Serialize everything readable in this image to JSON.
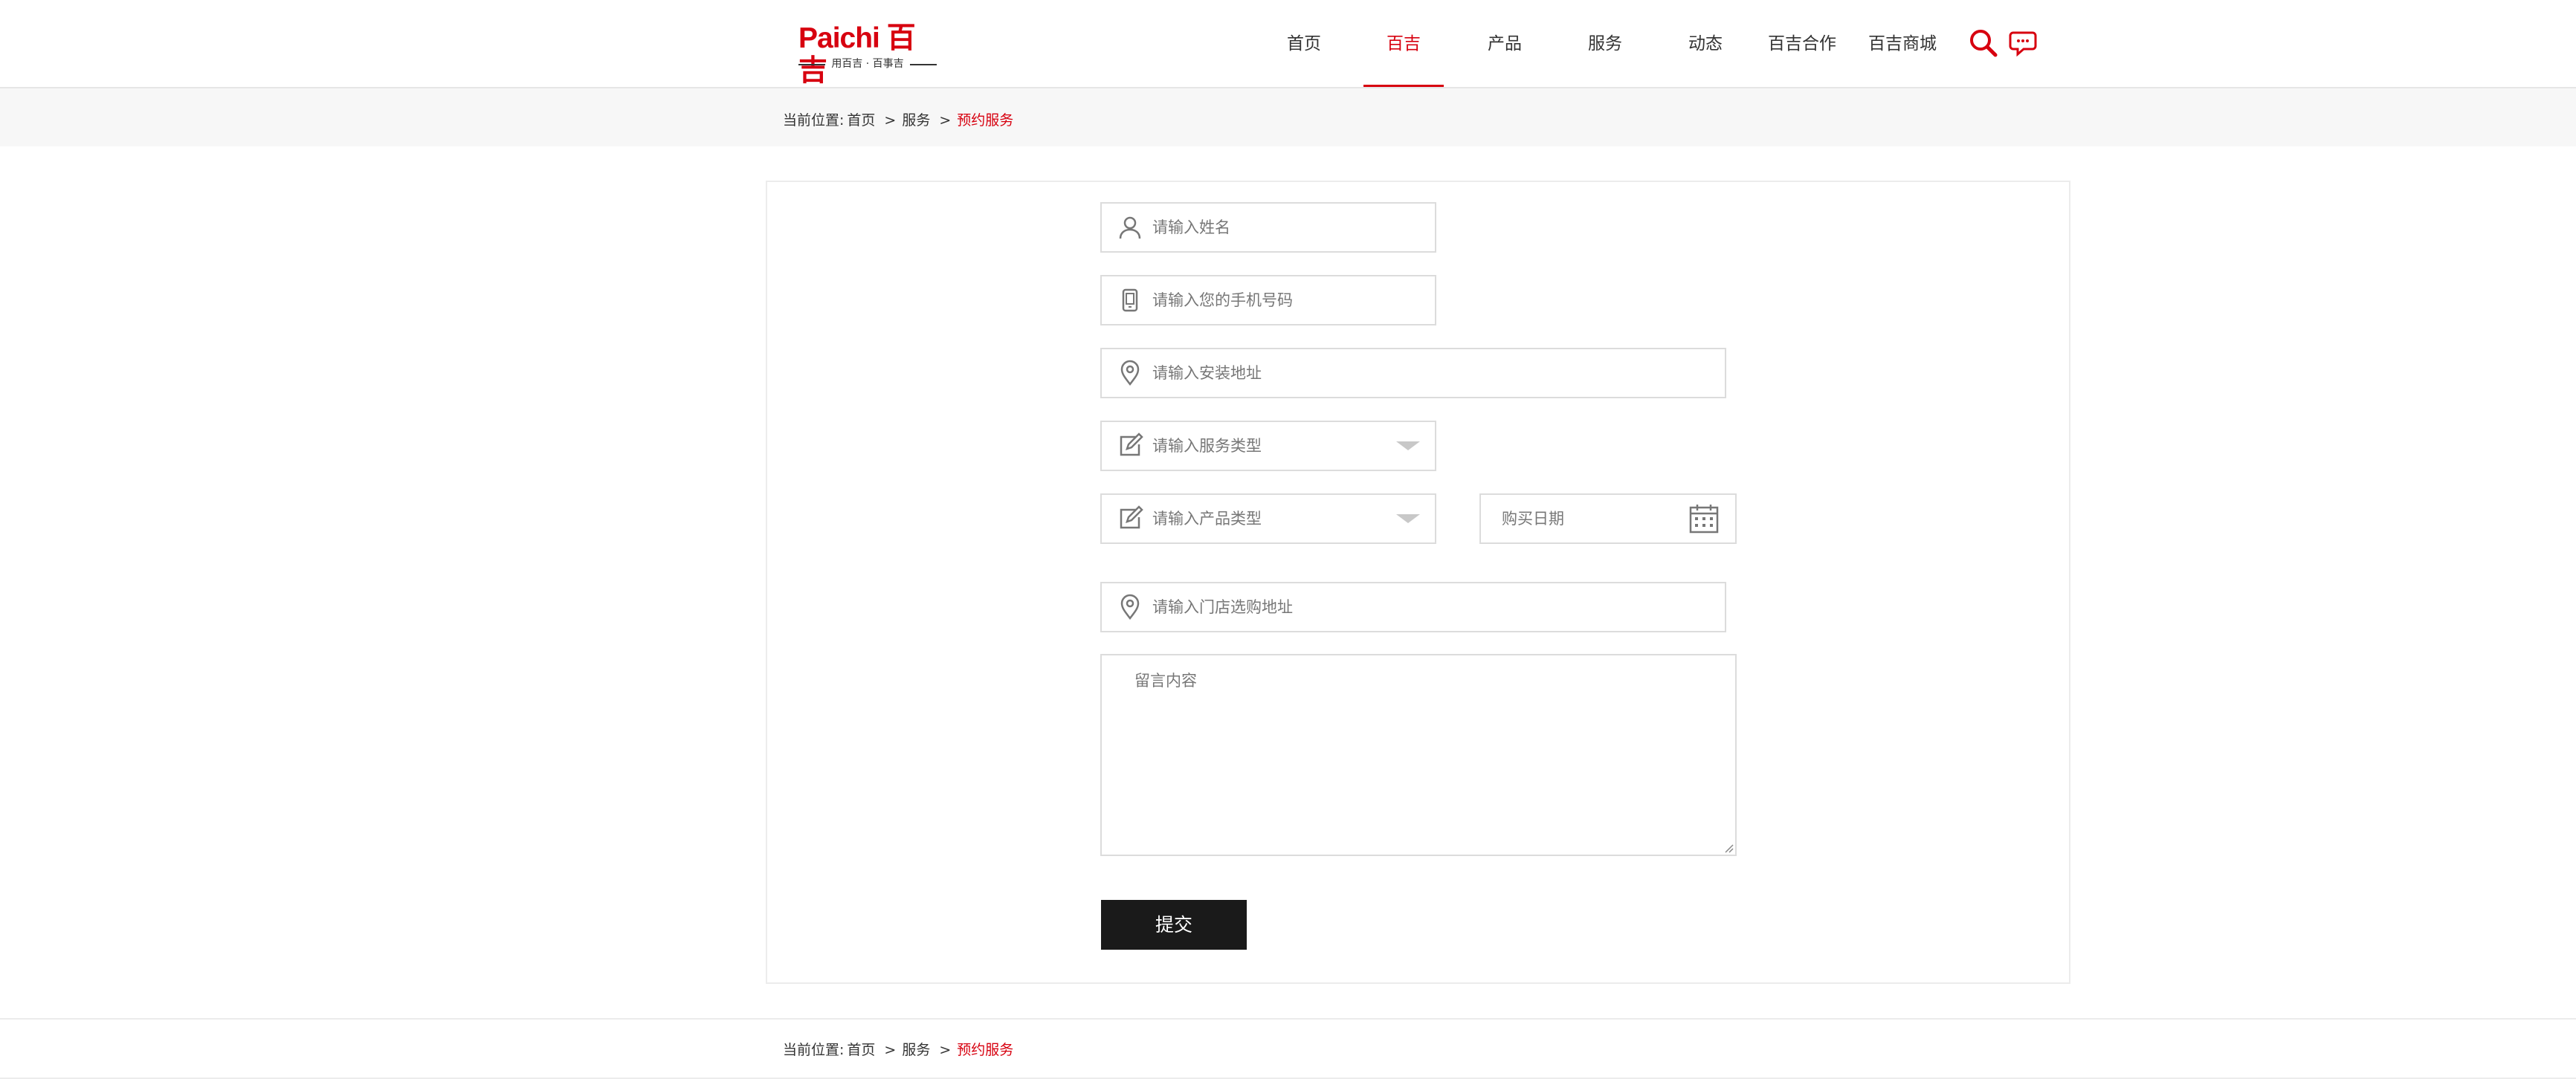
{
  "logo": {
    "brand": "Paichi 百吉",
    "slogan": "用百吉 · 百事吉"
  },
  "nav": {
    "items": [
      {
        "label": "首页"
      },
      {
        "label": "百吉"
      },
      {
        "label": "产品"
      },
      {
        "label": "服务"
      },
      {
        "label": "动态"
      },
      {
        "label": "百吉合作"
      },
      {
        "label": "百吉商城"
      }
    ],
    "active": "百吉",
    "icons": [
      "search-icon",
      "chat-icon"
    ]
  },
  "breadcrumb": {
    "prefix": "当前位置:",
    "items": [
      "首页",
      "服务",
      "预约服务"
    ],
    "separator": ">"
  },
  "form": {
    "name_placeholder": "请输入姓名",
    "phone_placeholder": "请输入您的手机号码",
    "address_placeholder": "请输入安装地址",
    "service_type_placeholder": "请输入服务类型",
    "product_type_placeholder": "请输入产品类型",
    "purchase_date_placeholder": "购买日期",
    "store_address_placeholder": "请输入门店选购地址",
    "message_placeholder": "留言内容",
    "submit_label": "提交"
  },
  "colors": {
    "accent": "#d7000f",
    "button": "#1a1a1a",
    "border": "#dcdcdc"
  }
}
